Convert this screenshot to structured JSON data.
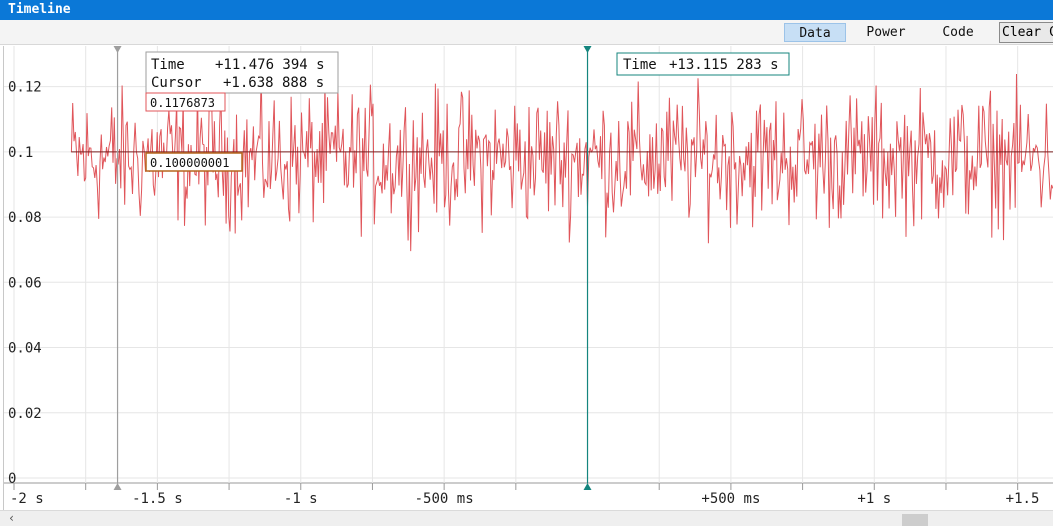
{
  "window": {
    "title": "Timeline"
  },
  "toolbar": {
    "tabs": [
      {
        "label": "Data",
        "active": true
      },
      {
        "label": "Power",
        "active": false
      },
      {
        "label": "Code",
        "active": false
      }
    ],
    "clear_label": "Clear C"
  },
  "readout": {
    "time_label": "Time",
    "time_value": "+11.476 394 s",
    "cursor_label": "Cursor",
    "cursor_value": "+1.638 888 s",
    "marker_value": "0.1176873",
    "level_value": "0.100000001",
    "right_time_label": "Time",
    "right_time_value": "+13.115 283 s"
  },
  "colors": {
    "signal": "#e0555a",
    "cursor_left": "#9e9e9e",
    "cursor_right": "#14857e",
    "level_line": "#7a1f1f",
    "grid": "#e6e6e6"
  },
  "chart_data": {
    "type": "line",
    "y_ticks": [
      "0",
      "0.02",
      "0.04",
      "0.06",
      "0.08",
      "0.1",
      "0.12"
    ],
    "x_ticks": [
      "-2 s",
      "-1.5 s",
      "-1 s",
      "-500 ms",
      "+500 ms",
      "+1 s",
      "+1.5"
    ],
    "x_unit": "s",
    "xlim": [
      -2,
      1.55
    ],
    "ylim": [
      0,
      0.13
    ],
    "series": [
      {
        "mean": 0.1,
        "min": 0.068,
        "max": 0.128
      }
    ],
    "level": 0.1,
    "cursor_left_x": -1.638888,
    "cursor_right_x": 0
  },
  "scrollbar": {
    "left_arrow": "‹"
  }
}
